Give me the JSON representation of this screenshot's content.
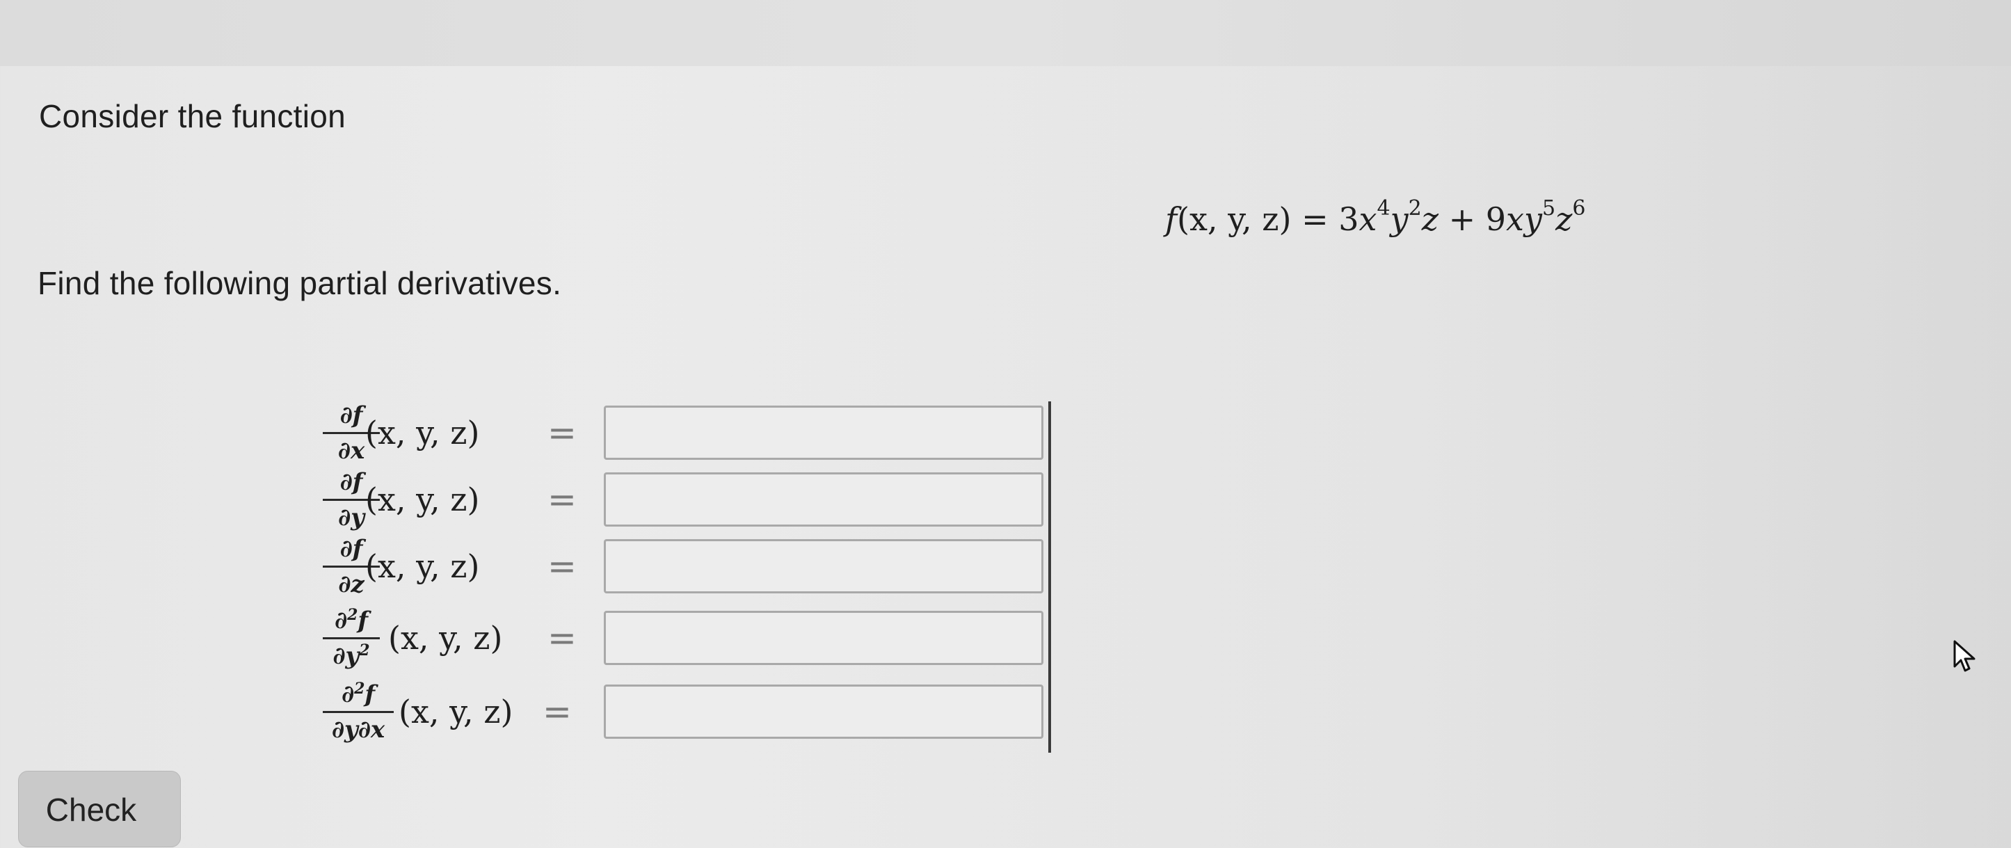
{
  "question": {
    "intro": "Consider the function",
    "instructions": "Find the following partial derivatives."
  },
  "function": {
    "lhs_name": "f",
    "variables": "(x, y, z)",
    "equals": "=",
    "term1_coefficient": "3",
    "term1_x": "x",
    "term1_x_exp": "4",
    "term1_y": "y",
    "term1_y_exp": "2",
    "term1_z": "z",
    "plus": "+",
    "term2_coefficient": "9",
    "term2_x": "x",
    "term2_y": "y",
    "term2_y_exp": "5",
    "term2_z": "z",
    "term2_z_exp": "6"
  },
  "derivatives": [
    {
      "numerator": "∂f",
      "denominator": "∂x",
      "den_sup": "",
      "num_sup": "",
      "args": "(x, y, z)",
      "equals": "=",
      "value": ""
    },
    {
      "numerator": "∂f",
      "denominator": "∂y",
      "den_sup": "",
      "num_sup": "",
      "args": "(x, y, z)",
      "equals": "=",
      "value": ""
    },
    {
      "numerator": "∂f",
      "denominator": "∂z",
      "den_sup": "",
      "num_sup": "",
      "args": "(x, y, z)",
      "equals": "=",
      "value": ""
    },
    {
      "numerator": "∂",
      "num_sup": "2",
      "num_tail": "f",
      "denominator": "∂y",
      "den_sup": "2",
      "args": "(x, y, z)",
      "equals": "=",
      "value": ""
    },
    {
      "numerator": "∂",
      "num_sup": "2",
      "num_tail": "f",
      "denominator": "∂y∂x",
      "den_sup": "",
      "args": "(x, y, z)",
      "equals": "=",
      "value": ""
    }
  ],
  "check_button": {
    "label": "Check"
  },
  "icons": {
    "cursor": "mouse-pointer-icon"
  }
}
